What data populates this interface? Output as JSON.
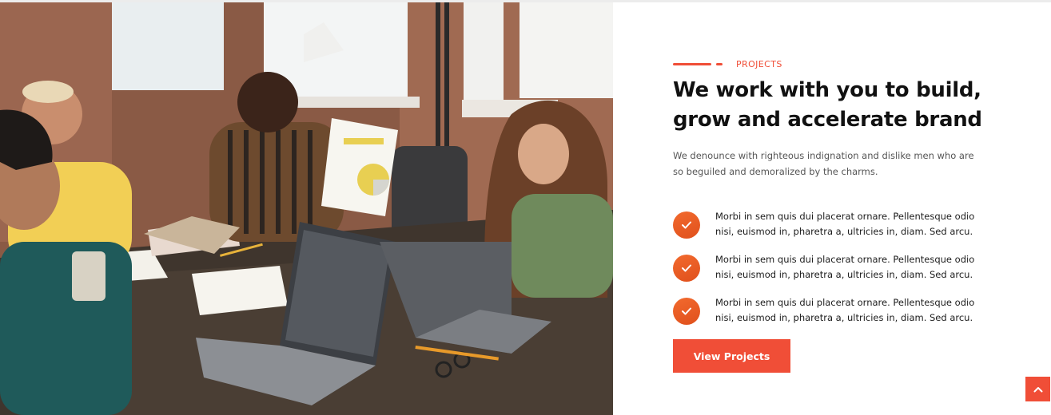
{
  "section": {
    "eyebrow": "PROJECTS",
    "title_line_1": "We work with you to build,",
    "title_line_2": "grow and accelerate brand",
    "lead_line_1": "We denounce with righteous indignation and dislike men who are",
    "lead_line_2": "so beguiled and demoralized by the charms.",
    "features": [
      {
        "line_1": "Morbi in sem quis dui placerat ornare. Pellentesque odio",
        "line_2": "nisi, euismod in, pharetra a, ultricies in, diam. Sed arcu.",
        "icon": "check-icon"
      },
      {
        "line_1": "Morbi in sem quis dui placerat ornare. Pellentesque odio",
        "line_2": "nisi, euismod in, pharetra a, ultricies in, diam. Sed arcu.",
        "icon": "check-icon"
      },
      {
        "line_1": "Morbi in sem quis dui placerat ornare. Pellentesque odio",
        "line_2": "nisi, euismod in, pharetra a, ultricies in, diam. Sed arcu.",
        "icon": "check-icon"
      }
    ],
    "button_label": "View Projects"
  },
  "scroll_top": {
    "icon": "chevron-up-icon"
  },
  "photo": {
    "subject": "team-meeting-photo"
  },
  "colors": {
    "accent": "#f04e37",
    "check_gradient_start": "#f26a2e",
    "check_gradient_end": "#e0501c",
    "title": "#111111",
    "body_text": "#555555"
  }
}
